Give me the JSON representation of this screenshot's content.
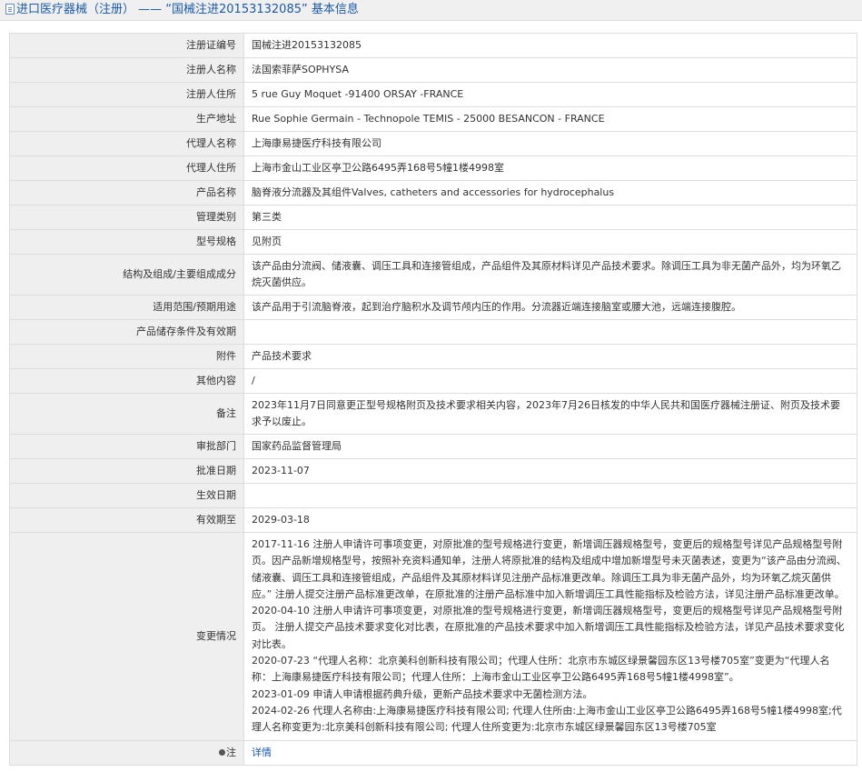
{
  "header": {
    "title": "进口医疗器械（注册） —— “国械注进20153132085” 基本信息"
  },
  "rows": [
    {
      "label": "注册证编号",
      "value": "国械注进20153132085"
    },
    {
      "label": "注册人名称",
      "value": "法国索菲萨SOPHYSA"
    },
    {
      "label": "注册人住所",
      "value": "5 rue Guy Moquet -91400 ORSAY -FRANCE"
    },
    {
      "label": "生产地址",
      "value": "Rue Sophie Germain - Technopole TEMIS - 25000 BESANCON - FRANCE"
    },
    {
      "label": "代理人名称",
      "value": "上海康易捷医疗科技有限公司"
    },
    {
      "label": "代理人住所",
      "value": "上海市金山工业区亭卫公路6495弄168号5幢1楼4998室"
    },
    {
      "label": "产品名称",
      "value": "脑脊液分流器及其组件Valves, catheters and accessories for hydrocephalus"
    },
    {
      "label": "管理类别",
      "value": "第三类"
    },
    {
      "label": "型号规格",
      "value": "见附页"
    },
    {
      "label": "结构及组成/主要组成成分",
      "value": "该产品由分流阀、储液囊、调压工具和连接管组成，产品组件及其原材料详见产品技术要求。除调压工具为非无菌产品外，均为环氧乙烷灭菌供应。"
    },
    {
      "label": "适用范围/预期用途",
      "value": "该产品用于引流脑脊液，起到治疗脑积水及调节颅内压的作用。分流器近端连接脑室或腰大池，远端连接腹腔。"
    },
    {
      "label": "产品储存条件及有效期",
      "value": ""
    },
    {
      "label": "附件",
      "value": "产品技术要求"
    },
    {
      "label": "其他内容",
      "value": "/"
    },
    {
      "label": "备注",
      "value": "2023年11月7日同意更正型号规格附页及技术要求相关内容，2023年7月26日核发的中华人民共和国医疗器械注册证、附页及技术要求予以废止。"
    },
    {
      "label": "审批部门",
      "value": "国家药品监督管理局"
    },
    {
      "label": "批准日期",
      "value": "2023-11-07"
    },
    {
      "label": "生效日期",
      "value": ""
    },
    {
      "label": "有效期至",
      "value": "2029-03-18"
    }
  ],
  "changes": {
    "label": "变更情况",
    "entries": [
      "2017-11-16 注册人申请许可事项变更，对原批准的型号规格进行变更，新增调压器规格型号，变更后的规格型号详见产品规格型号附页。因产品新增规格型号，按照补充资料通知单，注册人将原批准的结构及组成中增加新增型号未灭菌表述，变更为“该产品由分流阀、储液囊、调压工具和连接管组成，产品组件及其原材料详见注册产品标准更改单。除调压工具为非无菌产品外，均为环氧乙烷灭菌供应。” 注册人提交注册产品标准更改单，在原批准的注册产品标准中加入新增调压工具性能指标及检验方法，详见注册产品标准更改单。",
      "2020-04-10 注册人申请许可事项变更，对原批准的型号规格进行变更，新增调压器规格型号，变更后的规格型号详见产品规格型号附页。 注册人提交产品技术要求变化对比表，在原批准的产品技术要求中加入新增调压工具性能指标及检验方法，详见产品技术要求变化对比表。",
      "2020-07-23 “代理人名称：北京美科创新科技有限公司；代理人住所：北京市东城区绿景馨园东区13号楼705室”变更为“代理人名称：上海康易捷医疗科技有限公司；代理人住所：上海市金山工业区亭卫公路6495弄168号5幢1楼4998室”。",
      "2023-01-09 申请人申请根据药典升级，更新产品技术要求中无菌检测方法。",
      "2024-02-26 代理人名称由:上海康易捷医疗科技有限公司; 代理人住所由:上海市金山工业区亭卫公路6495弄168号5幢1楼4998室;代理人名称变更为:北京美科创新科技有限公司; 代理人住所变更为:北京市东城区绿景馨园东区13号楼705室"
    ]
  },
  "note": {
    "label": "注",
    "link_text": "详情"
  }
}
